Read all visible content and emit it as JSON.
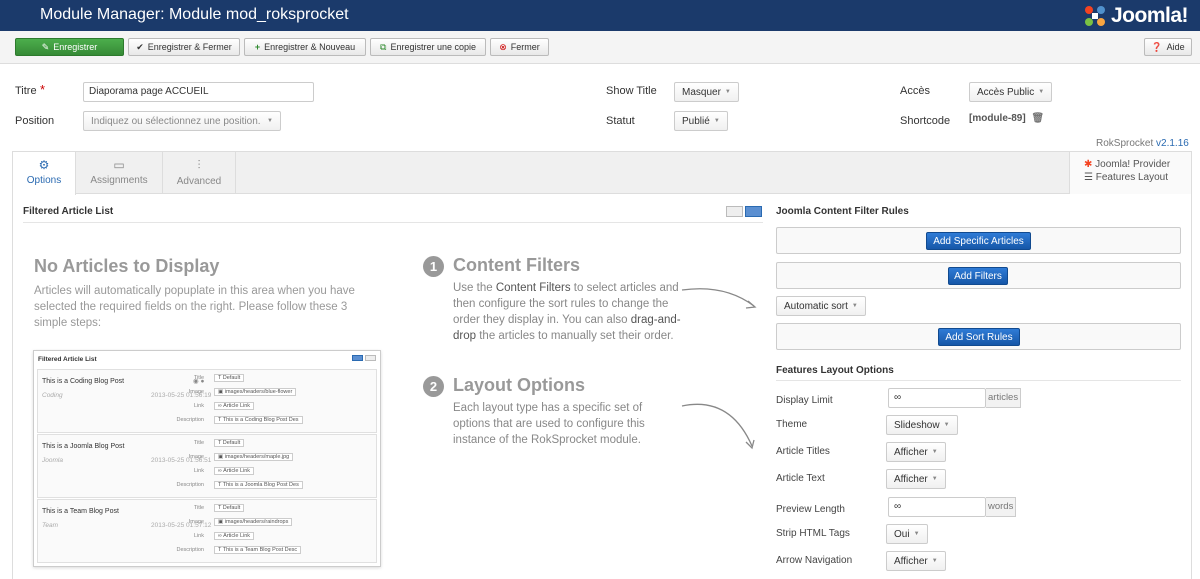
{
  "header": {
    "title": "Module Manager: Module mod_roksprocket",
    "logo_text": "Joomla!"
  },
  "toolbar": {
    "save": "Enregistrer",
    "save_close": "Enregistrer & Fermer",
    "save_new": "Enregistrer & Nouveau",
    "save_copy": "Enregistrer une copie",
    "close": "Fermer",
    "help": "Aide"
  },
  "form": {
    "title_label": "Titre",
    "title_required": "*",
    "title_value": "Diaporama page ACCUEIL",
    "position_label": "Position",
    "position_placeholder": "Indiquez ou sélectionnez une position.",
    "show_title_label": "Show Title",
    "show_title_value": "Masquer",
    "status_label": "Statut",
    "status_value": "Publié",
    "access_label": "Accès",
    "access_value": "Accès Public",
    "shortcode_label": "Shortcode",
    "shortcode_value": "[module-89]"
  },
  "version": {
    "name": "RokSprocket",
    "number": "v2.1.16"
  },
  "tabs": {
    "options": "Options",
    "assignments": "Assignments",
    "advanced": "Advanced",
    "provider": "Joomla! Provider",
    "layout": "Features Layout"
  },
  "left": {
    "section_title": "Filtered Article List",
    "no_articles_title": "No Articles to Display",
    "no_articles_text": "Articles will automatically popuplate in this area when you have selected the required fields on the right. Please follow these 3 simple steps:"
  },
  "steps": [
    {
      "num": "1",
      "title": "Content Filters",
      "text_pre": "Use the ",
      "text_bold": "Content Filters",
      "text_mid": " to select articles and then configure the sort rules to change the order they display in. You can also ",
      "text_bold2": "drag-and-drop",
      "text_post": " the articles to manually set their order."
    },
    {
      "num": "2",
      "title": "Layout Options",
      "text": "Each layout type has a specific set of options that are used to configure this instance of the RokSprocket module."
    }
  ],
  "preview": {
    "title": "Filtered Article List",
    "rows": [
      {
        "title": "This is a Coding Blog Post",
        "category": "Coding",
        "date": "2013-05-25 01:56:19",
        "image": "images/headers/blue-flower",
        "desc": "This is a Coding Blog Post Des"
      },
      {
        "title": "This is a Joomla Blog Post",
        "category": "Joomla",
        "date": "2013-05-25 01:56:51",
        "image": "images/headers/maple.jpg",
        "desc": "This is a Joomla Blog Post Des"
      },
      {
        "title": "This is a Team Blog Post",
        "category": "Team",
        "date": "2013-05-25 01:57:12",
        "image": "images/headers/raindrops",
        "desc": "This is a Team Blog Post Desc"
      }
    ],
    "labels": {
      "title": "Title",
      "image": "Image",
      "link": "Link",
      "description": "Description"
    },
    "values": {
      "default": "Default",
      "article_link": "Article Link",
      "t": "T"
    }
  },
  "right": {
    "filter_title": "Joomla Content Filter Rules",
    "add_specific": "Add Specific Articles",
    "add_filters": "Add Filters",
    "sort_value": "Automatic sort",
    "add_sort": "Add Sort Rules",
    "layout_title": "Features Layout Options",
    "display_limit_label": "Display Limit",
    "display_limit_value": "∞",
    "display_limit_addon": "articles",
    "theme_label": "Theme",
    "theme_value": "Slideshow",
    "article_titles_label": "Article Titles",
    "article_titles_value": "Afficher",
    "article_text_label": "Article Text",
    "article_text_value": "Afficher",
    "preview_length_label": "Preview Length",
    "preview_length_value": "∞",
    "preview_length_addon": "words",
    "strip_html_label": "Strip HTML Tags",
    "strip_html_value": "Oui",
    "arrow_nav_label": "Arrow Navigation",
    "arrow_nav_value": "Afficher"
  },
  "colors": {
    "header_bg": "#1b3a6b",
    "save_green": "#4cae4c",
    "primary_blue": "#1f6ac4",
    "link_blue": "#2a6ab1"
  }
}
